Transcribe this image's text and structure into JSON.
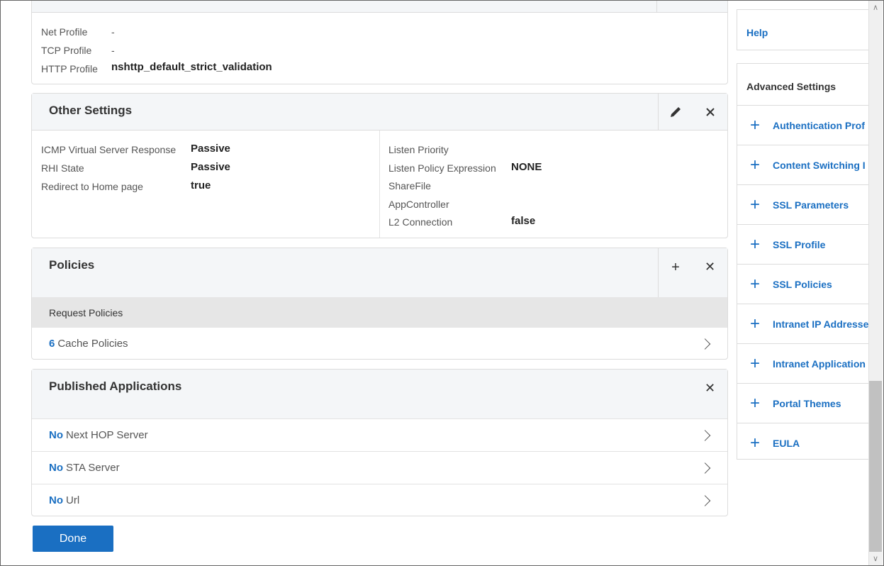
{
  "top_panel": {
    "fields": [
      {
        "label": "Net Profile",
        "value": "-"
      },
      {
        "label": "TCP Profile",
        "value": "-"
      },
      {
        "label": "HTTP Profile",
        "value": "nshttp_default_strict_validation"
      }
    ]
  },
  "other_settings": {
    "title": "Other Settings",
    "edit_icon": "pencil-icon",
    "close_icon": "close-icon",
    "left_fields": [
      {
        "label": "ICMP Virtual Server Response",
        "value": "Passive"
      },
      {
        "label": "RHI State",
        "value": "Passive"
      },
      {
        "label": "Redirect to Home page",
        "value": "true"
      }
    ],
    "right_fields": [
      {
        "label": "Listen Priority",
        "value": ""
      },
      {
        "label": "Listen Policy Expression",
        "value": "NONE"
      },
      {
        "label": "ShareFile",
        "value": ""
      },
      {
        "label": "AppController",
        "value": ""
      },
      {
        "label": "L2 Connection",
        "value": "false"
      }
    ]
  },
  "policies": {
    "title": "Policies",
    "add_label": "+",
    "close_label": "✕",
    "subheader": "Request Policies",
    "rows": [
      {
        "count": "6",
        "label": "Cache Policies"
      }
    ]
  },
  "published_applications": {
    "title": "Published Applications",
    "close_label": "✕",
    "rows": [
      {
        "count": "No",
        "label": "Next HOP Server"
      },
      {
        "count": "No",
        "label": "STA Server"
      },
      {
        "count": "No",
        "label": "Url"
      }
    ]
  },
  "done_label": "Done",
  "right_panel": {
    "help_label": "Help",
    "advanced_title": "Advanced Settings",
    "items": [
      "Authentication Prof",
      "Content Switching I",
      "SSL Parameters",
      "SSL Profile",
      "SSL Policies",
      "Intranet IP Addresse",
      "Intranet Application",
      "Portal Themes",
      "EULA"
    ]
  },
  "colors": {
    "accent": "#1a6fc2",
    "panel_header": "#f4f6f8",
    "subheader": "#e6e6e6"
  }
}
